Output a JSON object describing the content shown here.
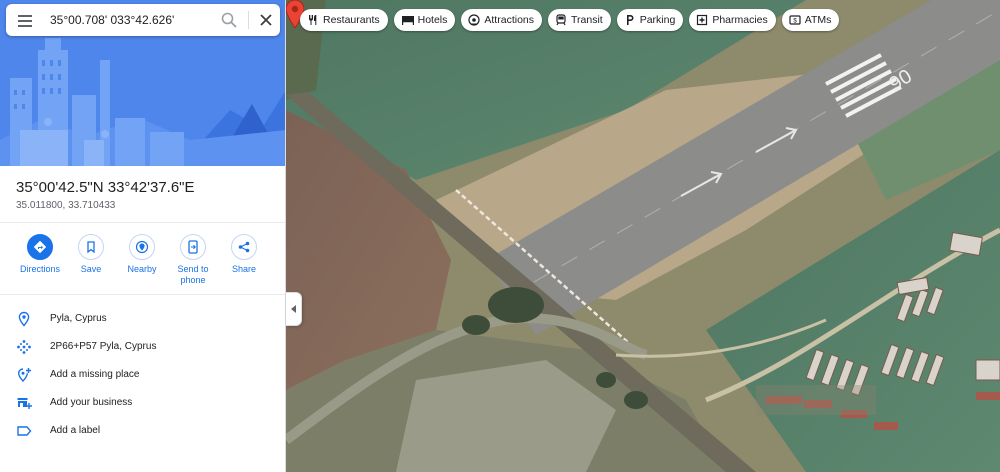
{
  "search": {
    "value": "35°00.708' 033°42.626'"
  },
  "place": {
    "title": "35°00'42.5\"N 33°42'37.6\"E",
    "subtitle": "35.011800, 33.710433"
  },
  "actions": [
    {
      "label": "Directions",
      "icon": "directions-icon"
    },
    {
      "label": "Save",
      "icon": "bookmark-icon"
    },
    {
      "label": "Nearby",
      "icon": "nearby-icon"
    },
    {
      "label": "Send to phone",
      "icon": "send-to-phone-icon"
    },
    {
      "label": "Share",
      "icon": "share-icon"
    }
  ],
  "info": [
    {
      "text": "Pyla, Cyprus",
      "icon": "location-pin-icon"
    },
    {
      "text": "2P66+P57 Pyla, Cyprus",
      "icon": "plus-code-icon"
    },
    {
      "text": "Add a missing place",
      "icon": "add-place-icon"
    },
    {
      "text": "Add your business",
      "icon": "add-business-icon"
    },
    {
      "text": "Add a label",
      "icon": "label-icon"
    }
  ],
  "chips": [
    {
      "label": "Restaurants",
      "icon": "restaurant-icon"
    },
    {
      "label": "Hotels",
      "icon": "hotel-icon"
    },
    {
      "label": "Attractions",
      "icon": "attractions-icon"
    },
    {
      "label": "Transit",
      "icon": "transit-icon"
    },
    {
      "label": "Parking",
      "icon": "parking-icon"
    },
    {
      "label": "Pharmacies",
      "icon": "pharmacy-icon"
    },
    {
      "label": "ATMs",
      "icon": "atm-icon"
    }
  ],
  "map": {
    "runway_marking": "06"
  },
  "colors": {
    "accent": "#1a73e8",
    "hero": "#4f86ec",
    "pin": "#ea4335"
  }
}
